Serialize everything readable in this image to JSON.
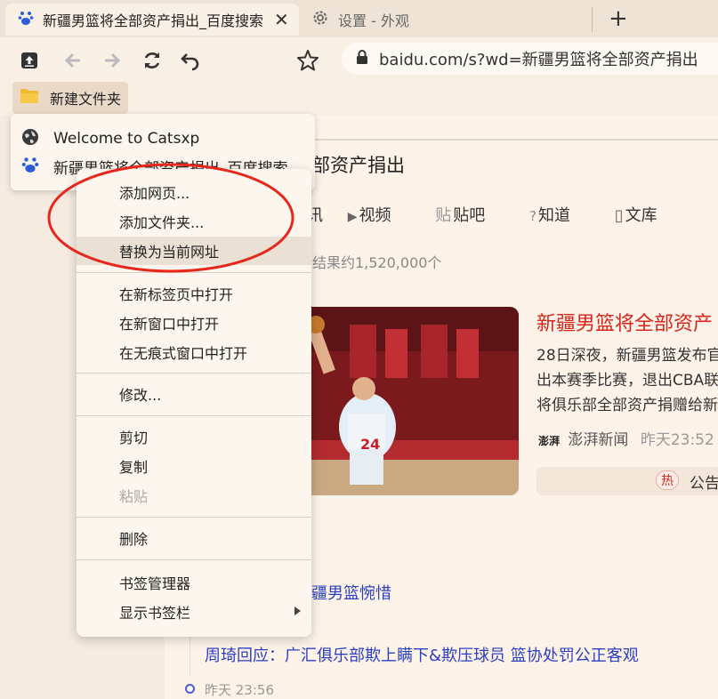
{
  "tabs": {
    "active_title": "新疆男篮将全部资产捐出_百度搜索",
    "second_title": "设置 - 外观"
  },
  "toolbar": {
    "url": "baidu.com/s?wd=新疆男篮将全部资产捐出"
  },
  "bookmarks_bar": {
    "folder_label": "新建文件夹"
  },
  "folder_popup": {
    "items": [
      "Welcome to Catsxp",
      "新疆男篮将全部资产捐出_百度搜索"
    ]
  },
  "context_menu": {
    "items": [
      "添加网页...",
      "添加文件夹...",
      "替换为当前网址",
      "在新标签页中打开",
      "在新窗口中打开",
      "在无痕式窗口中打开",
      "修改...",
      "剪切",
      "复制",
      "粘贴",
      "删除",
      "书签管理器",
      "显示书签栏"
    ]
  },
  "page": {
    "title_tail": "部资产捐出",
    "search_tabs": [
      "讯",
      "视频",
      "贴吧",
      "知道",
      "文库"
    ],
    "result_count": "结果约1,520,000个",
    "news_title": "新疆男篮将全部资产",
    "news_snippet_lines": [
      "28日深夜，新疆男篮发布官",
      "出本赛季比赛，退出CBA联",
      "将俱乐部全部资产捐赠给新"
    ],
    "news_source": "澎湃新闻",
    "news_source_logo": "澎湃",
    "news_time": "昨天23:52",
    "hot_badge": "热",
    "hot_label": "公告",
    "related_1": "疆男篮惋惜",
    "related_2": "周琦回应：广汇俱乐部欺上瞒下&欺压球员 篮协处罚公正客观",
    "related_time": "昨天 23:56"
  },
  "colors": {
    "accent_red": "#d7261a",
    "link_blue": "#2b3fc5",
    "annotation_red": "#e8261b"
  }
}
